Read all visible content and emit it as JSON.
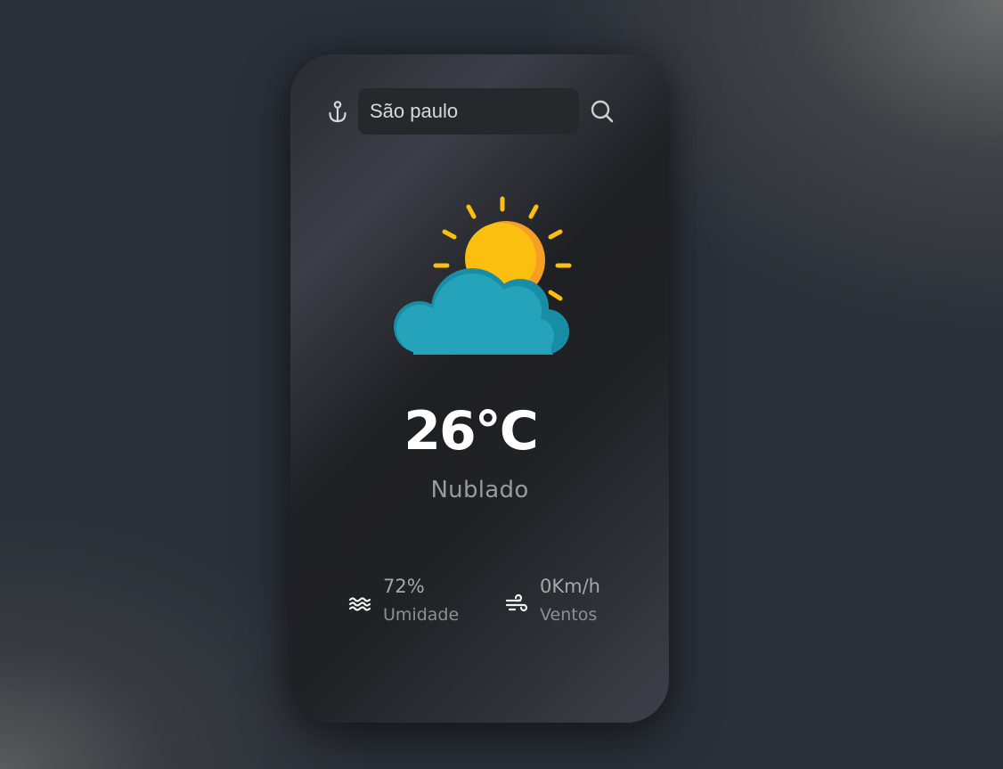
{
  "search": {
    "value": "São paulo"
  },
  "icons": {
    "location": "anchor-icon",
    "search": "search-icon",
    "weather": "partly-cloudy-icon",
    "humidity": "waves-icon",
    "wind": "wind-icon"
  },
  "weather": {
    "temperature": "26°C",
    "description": "Nublado"
  },
  "stats": {
    "humidity": {
      "value": "72%",
      "label": "Umidade"
    },
    "wind": {
      "value": "0Km/h",
      "label": "Ventos"
    }
  },
  "colors": {
    "sun": "#fbbf0f",
    "sun_shade": "#f59f25",
    "cloud": "#25a3bb",
    "cloud_shade": "#1a8da6",
    "temperature_text": "#ffffff",
    "muted_text": "#9a9a9e"
  }
}
